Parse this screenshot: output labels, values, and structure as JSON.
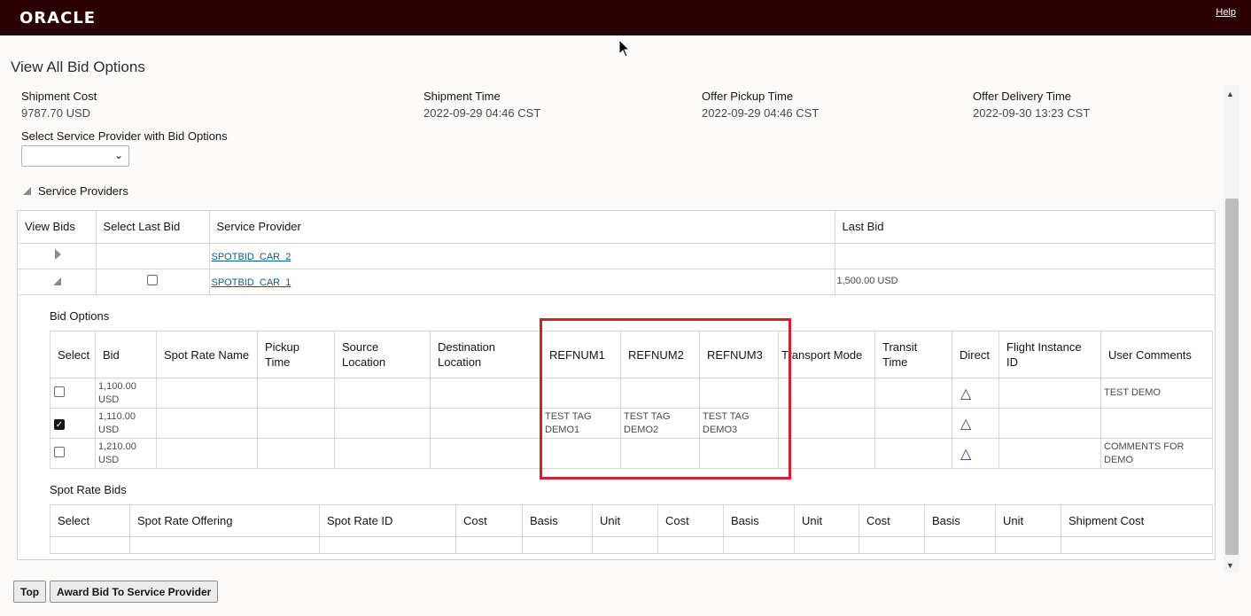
{
  "header": {
    "logo": "ORACLE",
    "help_link": "Help"
  },
  "page_title": "View All Bid Options",
  "summary": [
    {
      "label": "Shipment Cost",
      "value": "9787.70 USD"
    },
    {
      "label": "Shipment Time",
      "value": "2022-09-29 04:46 CST"
    },
    {
      "label": "Offer Pickup Time",
      "value": "2022-09-29 04:46 CST"
    },
    {
      "label": "Offer Delivery Time",
      "value": "2022-09-30 13:23 CST"
    }
  ],
  "select_provider": {
    "label": "Select Service Provider with Bid Options",
    "value": ""
  },
  "service_providers": {
    "section_title": "Service Providers",
    "columns": [
      "View Bids",
      "Select Last Bid",
      "Service Provider",
      "Last Bid"
    ],
    "rows": [
      {
        "provider": "SPOTBID_CAR_2",
        "last_bid": ""
      },
      {
        "provider": "SPOTBID_CAR_1",
        "last_bid": "1,500.00 USD"
      }
    ]
  },
  "bid_options": {
    "title": "Bid Options",
    "columns": {
      "select": "Select",
      "bid": "Bid",
      "spot_rate_name": "Spot Rate Name",
      "pickup_time": "Pickup Time",
      "source_location": "Source Location",
      "destination_location": "Destination Location",
      "refnum1": "REFNUM1",
      "refnum2": "REFNUM2",
      "refnum3": "REFNUM3",
      "transport_mode": "Transport Mode",
      "transit_time": "Transit Time",
      "direct": "Direct",
      "flight_instance_id": "Flight Instance ID",
      "user_comments": "User Comments"
    },
    "rows": [
      {
        "checked": false,
        "bid": "1,100.00 USD",
        "refnum1": "",
        "refnum2": "",
        "refnum3": "",
        "comments": "TEST DEMO"
      },
      {
        "checked": true,
        "bid": "1,110.00 USD",
        "refnum1": "TEST TAG DEMO1",
        "refnum2": "TEST TAG DEMO2",
        "refnum3": "TEST TAG DEMO3",
        "comments": ""
      },
      {
        "checked": false,
        "bid": "1,210.00 USD",
        "refnum1": "",
        "refnum2": "",
        "refnum3": "",
        "comments": "COMMENTS FOR DEMO"
      }
    ],
    "direct_icon": "triangle-outline-icon"
  },
  "spot_rate_bids": {
    "title": "Spot Rate Bids",
    "columns": [
      "Select",
      "Spot Rate Offering",
      "Spot Rate ID",
      "Cost",
      "Basis",
      "Unit",
      "Cost",
      "Basis",
      "Unit",
      "Cost",
      "Basis",
      "Unit",
      "Shipment Cost"
    ]
  },
  "buttons": {
    "top": "Top",
    "award": "Award Bid To Service Provider"
  },
  "colors": {
    "header_bg": "#2b0205",
    "highlight": "#d4202a",
    "link": "#0e5b8c"
  }
}
